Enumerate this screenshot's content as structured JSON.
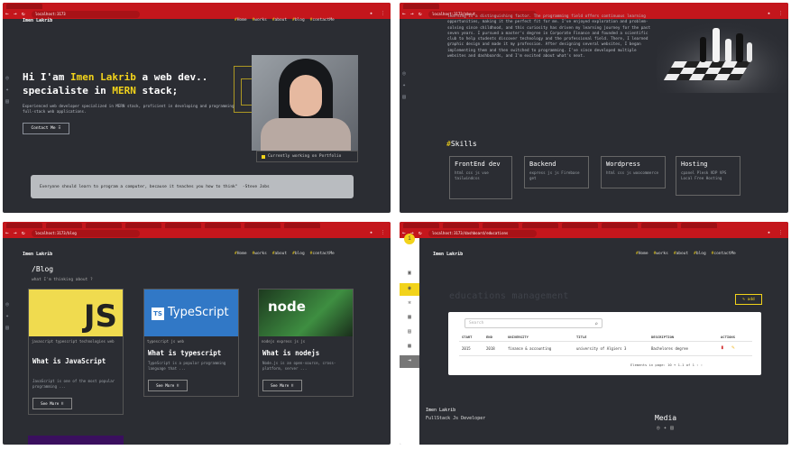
{
  "browser": {
    "url_home": "localhost:3173",
    "url_about": "localhost:3173/about",
    "url_blog": "localhost:3173/blog",
    "url_admin": "localhost:3173/dashboard/educations"
  },
  "site": {
    "brand": "Imen Lakrib",
    "nav": [
      "Home",
      "works",
      "about",
      "blog",
      "contactMe"
    ]
  },
  "home": {
    "hero_prefix": "Hi I'am ",
    "hero_name": "Imen Lakrib",
    "hero_mid": " a web dev..",
    "hero_line2_prefix": "specialiste in ",
    "hero_stack": "MERN",
    "hero_line2_suffix": " stack;",
    "intro": "Experienced web developer specialized in MERN stack, proficient in developing and programming full-stack web applications.",
    "contact_button": "Contact Me ⠿",
    "caption": "Currently working on Portfolio",
    "quote": "Everyone should learn to program a computer, because it teaches you how to think\"",
    "quote_author": "-Steve Jobs"
  },
  "about": {
    "paragraph": "learning is a distinguishing factor. The programming field offers continuous learning opportunities, making it the perfect fit for me. I've enjoyed exploration and problem-solving since childhood, and this curiosity has driven my learning journey for the past seven years. I pursued a master's degree in Corporate Finance and founded a scientific club to help students discover technology and the professional field. There, I learned graphic design and made it my profession. After designing several websites, I began implementing them and then switched to programming. I've since developed multiple websites and dashboards, and I'm excited about what's next.",
    "skills_title": "Skills",
    "skills": [
      {
        "title": "FrontEnd dev",
        "desc": "html css js vue tailwindcss"
      },
      {
        "title": "Backend",
        "desc": "express js js Firebase get"
      },
      {
        "title": "Wordpress",
        "desc": "html css js woocommerce"
      },
      {
        "title": "Hosting",
        "desc": "cpanel Plesk VDP VPS Local Free Hosting"
      }
    ]
  },
  "blog": {
    "title": "/Blog",
    "subtitle": "what I'm thinking about ?",
    "cards": [
      {
        "logo": "JS",
        "category": "javascript typescript technologies web",
        "title": "What is JavaScript",
        "desc": "JavaScript is one of the most popular programming ...",
        "read_more": "See More ⠿"
      },
      {
        "logo": "TypeScript",
        "category": "typescript js web",
        "title": "What is typescript",
        "desc": "TypeScript is a popular programming language that ...",
        "read_more": "See More ⠿"
      },
      {
        "logo": "node",
        "category": "nodejs express js js",
        "title": "What is nodejs",
        "desc": "Node.js is an open-source, cross-platform, server ...",
        "read_more": "See More ⠿"
      }
    ]
  },
  "admin": {
    "title": "educations management",
    "add_button": "add",
    "search_placeholder": "Search",
    "columns": [
      "START",
      "END",
      "UNIVERSITY",
      "TITLE",
      "DESCRIPTION",
      "ACTIONS"
    ],
    "rows": [
      {
        "start": "2015",
        "end": "2018",
        "university": "finance & accounting",
        "title": "university of Algiers 3",
        "description": "Bachelores degree"
      }
    ],
    "pagination": "Elements in page: 10 ▾   1-1 of 1   ‹  ›",
    "footer_name": "Imen Lakrib",
    "footer_role": "FullStack Js Developer",
    "footer_media": "Media"
  },
  "colors": {
    "accent": "#f2d31b",
    "bg": "#2b2d33",
    "browser": "#c4161c"
  }
}
